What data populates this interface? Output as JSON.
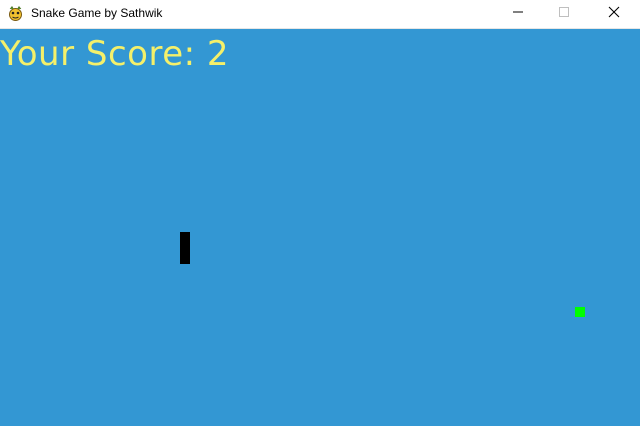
{
  "window": {
    "title": "Snake Game by Sathwik",
    "icon": "pygame-snake-icon"
  },
  "controls": {
    "minimize": "minimize-icon",
    "maximize": "maximize-icon",
    "close": "close-icon"
  },
  "game": {
    "score_text": "Your Score: 2",
    "score": 2,
    "colors": {
      "background": "#3397d3",
      "score_text": "#f5f06a",
      "snake": "#000000",
      "food": "#00ff00"
    }
  }
}
